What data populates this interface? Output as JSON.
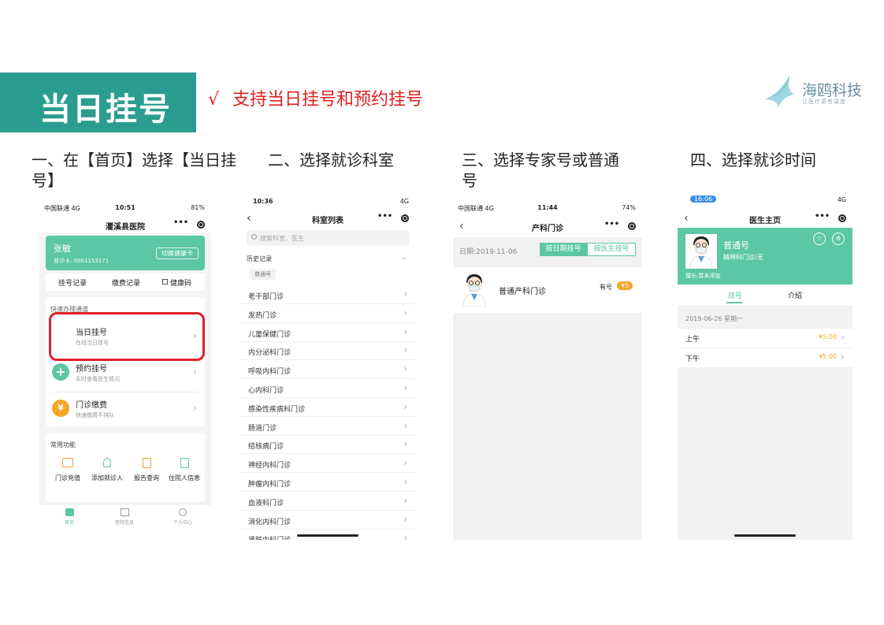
{
  "header": {
    "title": "当日挂号",
    "check_mark": "√",
    "check_text": "支持当日挂号和预约挂号",
    "logo_name": "海鸥科技",
    "logo_sub": "让医疗更有温度"
  },
  "steps": {
    "s1_line1": "一、在【首页】选择【当日挂",
    "s1_line2": "号】",
    "s2": "二、选择就诊科室",
    "s3_line1": "三、选择专家号或普通",
    "s3_line2": "号",
    "s4": "四、选择就诊时间"
  },
  "phone1": {
    "carrier": "中国联通 4G",
    "time": "10:51",
    "battery": "81%",
    "title": "灈溪县医院",
    "patient_name": "张敏",
    "patient_card": "普诊卡: 0001153171",
    "switch_card": "切换健康卡",
    "tabs": [
      "挂号记录",
      "缴费记录",
      "健康码"
    ],
    "quick_title": "快速办理通道",
    "menu": [
      {
        "title": "当日挂号",
        "sub": "在线当日挂号"
      },
      {
        "title": "预约挂号",
        "sub": "实时查看医生情况"
      },
      {
        "title": "门诊缴费",
        "sub": "快速缴费不排队"
      }
    ],
    "common_title": "常用功能",
    "functions": [
      "门诊充值",
      "添加就诊人",
      "报告查询",
      "住院人信息"
    ],
    "bottom_nav": [
      "首页",
      "医院信息",
      "个人中心"
    ]
  },
  "phone2": {
    "time": "10:36",
    "network": "4G",
    "title": "科室列表",
    "search_placeholder": "搜索科室、医生",
    "history_label": "历史记录",
    "history_tag": "普通号",
    "departments": [
      "老干部门诊",
      "发热门诊",
      "儿童保健门诊",
      "内分泌科门诊",
      "呼吸内科门诊",
      "心内科门诊",
      "感染性疾病科门诊",
      "肠道门诊",
      "结核病门诊",
      "神经内科门诊",
      "肿瘤内科门诊",
      "血液科门诊",
      "消化内科门诊",
      "肾脏内科门诊"
    ]
  },
  "phone3": {
    "carrier": "中国联通 4G",
    "time": "11:44",
    "battery": "74%",
    "title": "产科门诊",
    "date_label": "日期:2019-11-06",
    "tab_by_date": "按日期挂号",
    "tab_by_doctor": "按医生挂号",
    "doctor_name": "普通产科门诊",
    "availability": "有号",
    "price": "¥5"
  },
  "phone4": {
    "time": "16:06",
    "network": "4G",
    "title": "医生主页",
    "doctor_name": "普通号",
    "doctor_dept": "精神科门诊/无",
    "expertise": "擅长:暂未添加",
    "tab_register": "挂号",
    "tab_intro": "介绍",
    "date": "2019-06-26 星期一",
    "slots": [
      {
        "label": "上午",
        "price": "¥5.00"
      },
      {
        "label": "下午",
        "price": "¥5.00"
      }
    ]
  },
  "colors": {
    "brand_teal": "#2a9d8f",
    "accent_red": "#e02020",
    "card_green": "#5cc7a5",
    "orange": "#f5a623"
  }
}
